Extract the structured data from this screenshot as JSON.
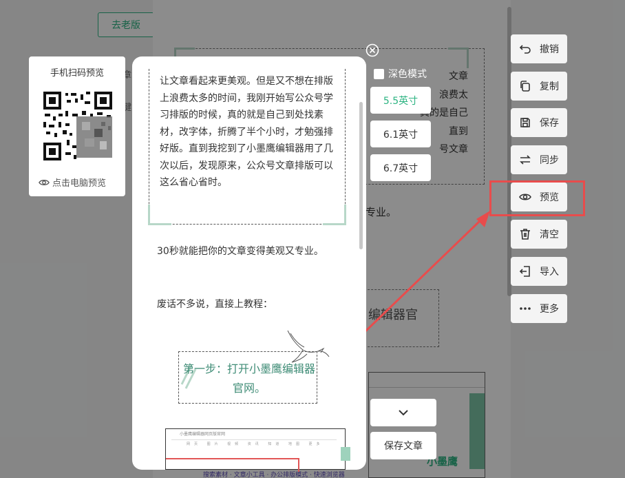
{
  "background": {
    "old_version_label": "去老版",
    "frame_lines": [
      "文章",
      "浪费太",
      "真的是自己",
      "直到",
      "号文章"
    ],
    "side_text": "专业。",
    "stamp_text": "编辑器官",
    "brand_fragment": "小墨鹰",
    "footer_fragment": "搜索素材 · 文章小工具 · 办公排版模式 · 快速浏览器"
  },
  "toolbar": {
    "items": [
      {
        "label": "撤销",
        "icon": "undo-icon"
      },
      {
        "label": "复制",
        "icon": "copy-icon"
      },
      {
        "label": "保存",
        "icon": "save-icon"
      },
      {
        "label": "同步",
        "icon": "sync-icon"
      },
      {
        "label": "预览",
        "icon": "eye-icon"
      },
      {
        "label": "清空",
        "icon": "trash-icon"
      },
      {
        "label": "导入",
        "icon": "import-icon"
      },
      {
        "label": "更多",
        "icon": "more-icon"
      }
    ],
    "highlighted": "预览",
    "highlight_color": "#e84c4c"
  },
  "qr_card": {
    "title": "手机扫码预览",
    "pc_preview_label": "点击电脑预览"
  },
  "preview": {
    "frame_text": "让文章看起来更美观。但是又不想在排版上浪费太多的时间，我刚开始写公众号学习排版的时候，真的就是自己到处找素材，改字体，折腾了半个小时，才勉强排好版。直到我挖到了小墨鹰编辑器用了几次以后，发现原来，公众号文章排版可以这么省心省时。",
    "para1": "30秒就能把你的文章变得美观又专业。",
    "para2": "废话不多说，直接上教程：",
    "step_title": "第一步：打开小墨鹰编辑器官网。",
    "screenshot_search": "小墨鹰编辑器网页版官网",
    "screenshot_nav": "网页 图片 视频 资讯 知道 地图 更多"
  },
  "controls": {
    "dark_mode_label": "深色模式",
    "sizes": [
      "5.5英寸",
      "6.1英寸",
      "6.7英寸"
    ],
    "active_size": "5.5英寸",
    "save_article_label": "保存文章",
    "accent_color": "#2bb381"
  }
}
